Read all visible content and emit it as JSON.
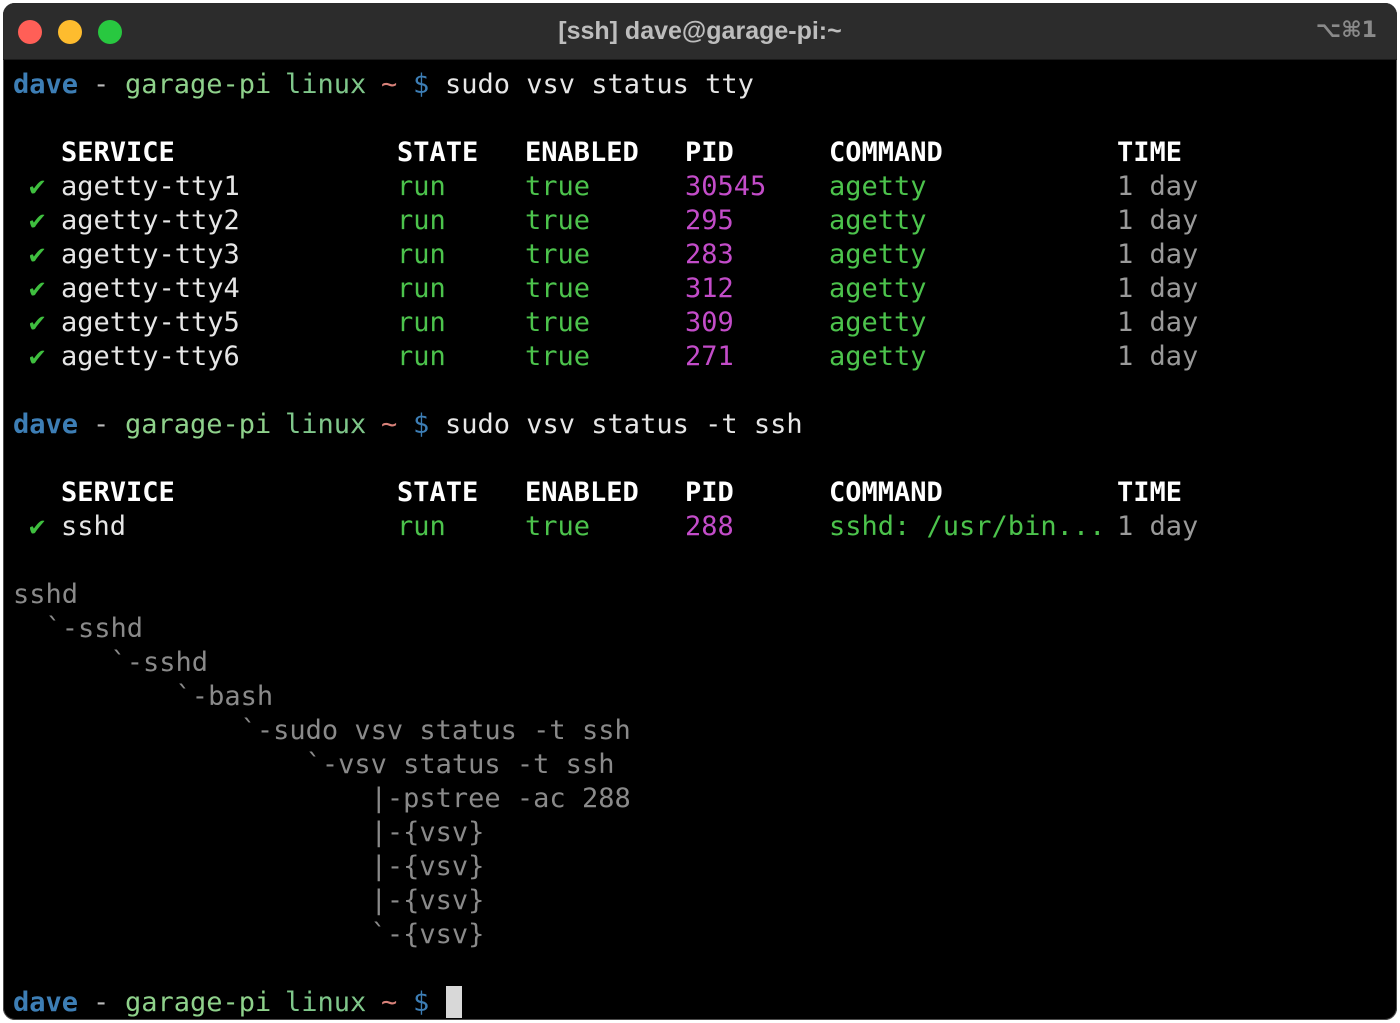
{
  "window": {
    "title": "[ssh] dave@garage-pi:~",
    "shortcut": "⌥⌘1"
  },
  "prompt": {
    "user": "dave",
    "sep": "-",
    "host": "garage-pi",
    "os": "linux",
    "dir": "~",
    "symbol": "$"
  },
  "commands": [
    "sudo vsv status tty",
    "sudo vsv status -t ssh"
  ],
  "headers": {
    "service": "SERVICE",
    "state": "STATE",
    "enabled": "ENABLED",
    "pid": "PID",
    "command": "COMMAND",
    "time": "TIME"
  },
  "table1": [
    {
      "check": "✔",
      "service": "agetty-tty1",
      "state": "run",
      "enabled": "true",
      "pid": "30545",
      "command": "agetty",
      "time": "1 day"
    },
    {
      "check": "✔",
      "service": "agetty-tty2",
      "state": "run",
      "enabled": "true",
      "pid": "295",
      "command": "agetty",
      "time": "1 day"
    },
    {
      "check": "✔",
      "service": "agetty-tty3",
      "state": "run",
      "enabled": "true",
      "pid": "283",
      "command": "agetty",
      "time": "1 day"
    },
    {
      "check": "✔",
      "service": "agetty-tty4",
      "state": "run",
      "enabled": "true",
      "pid": "312",
      "command": "agetty",
      "time": "1 day"
    },
    {
      "check": "✔",
      "service": "agetty-tty5",
      "state": "run",
      "enabled": "true",
      "pid": "309",
      "command": "agetty",
      "time": "1 day"
    },
    {
      "check": "✔",
      "service": "agetty-tty6",
      "state": "run",
      "enabled": "true",
      "pid": "271",
      "command": "agetty",
      "time": "1 day"
    }
  ],
  "table2": [
    {
      "check": "✔",
      "service": "sshd",
      "state": "run",
      "enabled": "true",
      "pid": "288",
      "command": "sshd: /usr/bin...",
      "time": "1 day"
    }
  ],
  "tree": [
    "sshd",
    "  `-sshd",
    "      `-sshd",
    "          `-bash",
    "              `-sudo vsv status -t ssh",
    "                  `-vsv status -t ssh",
    "                      |-pstree -ac 288",
    "                      |-{vsv}",
    "                      |-{vsv}",
    "                      |-{vsv}",
    "                      `-{vsv}"
  ],
  "colors": {
    "user": "#3d7eb5",
    "host": "#8fd18b",
    "tilde": "#d9827a",
    "green": "#4cc34c",
    "pid": "#c34cc9",
    "background": "#000000"
  }
}
